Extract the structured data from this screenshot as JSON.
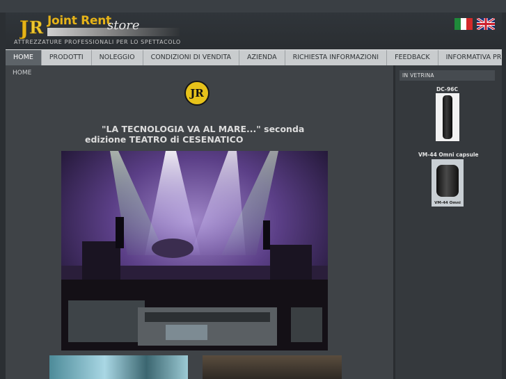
{
  "header": {
    "logo_mark": "JR",
    "logo_title": "Joint Rent",
    "logo_store": "store",
    "tagline": "ATTREZZATURE PROFESSIONALI PER LO SPETTACOLO",
    "flags": [
      {
        "name": "italian-flag",
        "colors": [
          "#1f8a3a",
          "#ffffff",
          "#d22a2a"
        ]
      },
      {
        "name": "english-flag",
        "colors": [
          "#1f2f73",
          "#ffffff",
          "#cc1f2c"
        ]
      }
    ]
  },
  "nav": {
    "items": [
      {
        "label": "HOME",
        "active": true
      },
      {
        "label": "PRODOTTI",
        "active": false
      },
      {
        "label": "NOLEGGIO",
        "active": false
      },
      {
        "label": "CONDIZIONI DI VENDITA",
        "active": false
      },
      {
        "label": "AZIENDA",
        "active": false
      },
      {
        "label": "RICHIESTA INFORMAZIONI",
        "active": false
      },
      {
        "label": "FEEDBACK",
        "active": false
      },
      {
        "label": "INFORMATIVA PRIVACY",
        "active": false
      }
    ]
  },
  "main": {
    "breadcrumb": "HOME",
    "badge": "JR",
    "headline_line1": "\"LA TECNOLOGIA VA AL MARE...\" seconda",
    "headline_line2": "edizione TEATRO di CESENATICO"
  },
  "sidebar": {
    "heading": "IN VETRINA",
    "products": [
      {
        "title": "DC-96C"
      },
      {
        "title": "VM-44 Omni capsule",
        "image_caption": "VM-44 Omni"
      }
    ]
  },
  "colors": {
    "accent": "#e6b318",
    "nav_active": "#5d6368",
    "nav_bg": "#c9ccce",
    "page_bg": "#2b2f33"
  }
}
